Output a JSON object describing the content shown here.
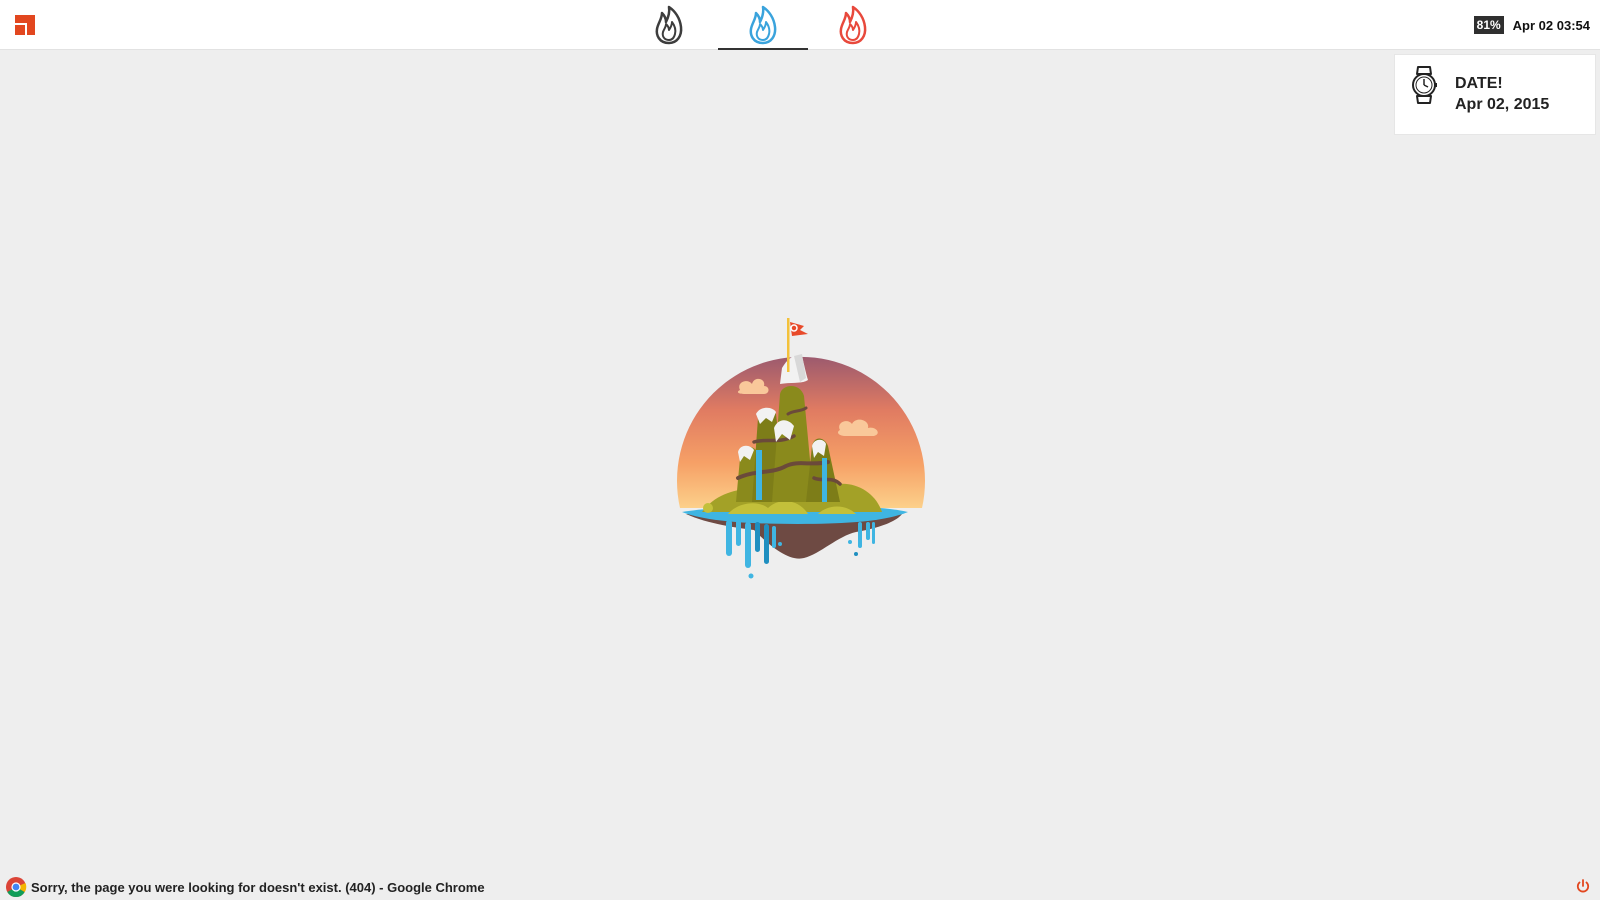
{
  "topbar": {
    "menu_icon": "app-menu-icon",
    "accent_color": "#e2471f",
    "workspaces": [
      {
        "icon": "flame-icon",
        "color": "#3d3d3d",
        "active": false
      },
      {
        "icon": "flame-icon",
        "color": "#3aa3dc",
        "active": true
      },
      {
        "icon": "flame-icon",
        "color": "#e8493c",
        "active": false
      }
    ],
    "battery": "81%",
    "clock": "Apr 02 03:54"
  },
  "notification": {
    "icon": "watch-icon",
    "title": "DATE!",
    "body": "Apr 02, 2015"
  },
  "scene": {
    "illustration": "floating-island-illustration"
  },
  "statusbar": {
    "app_icon": "chrome-icon",
    "window_title": "Sorry, the page you were looking for doesn't exist. (404) - Google Chrome",
    "power_icon": "power-icon",
    "power_color": "#e2471f"
  }
}
